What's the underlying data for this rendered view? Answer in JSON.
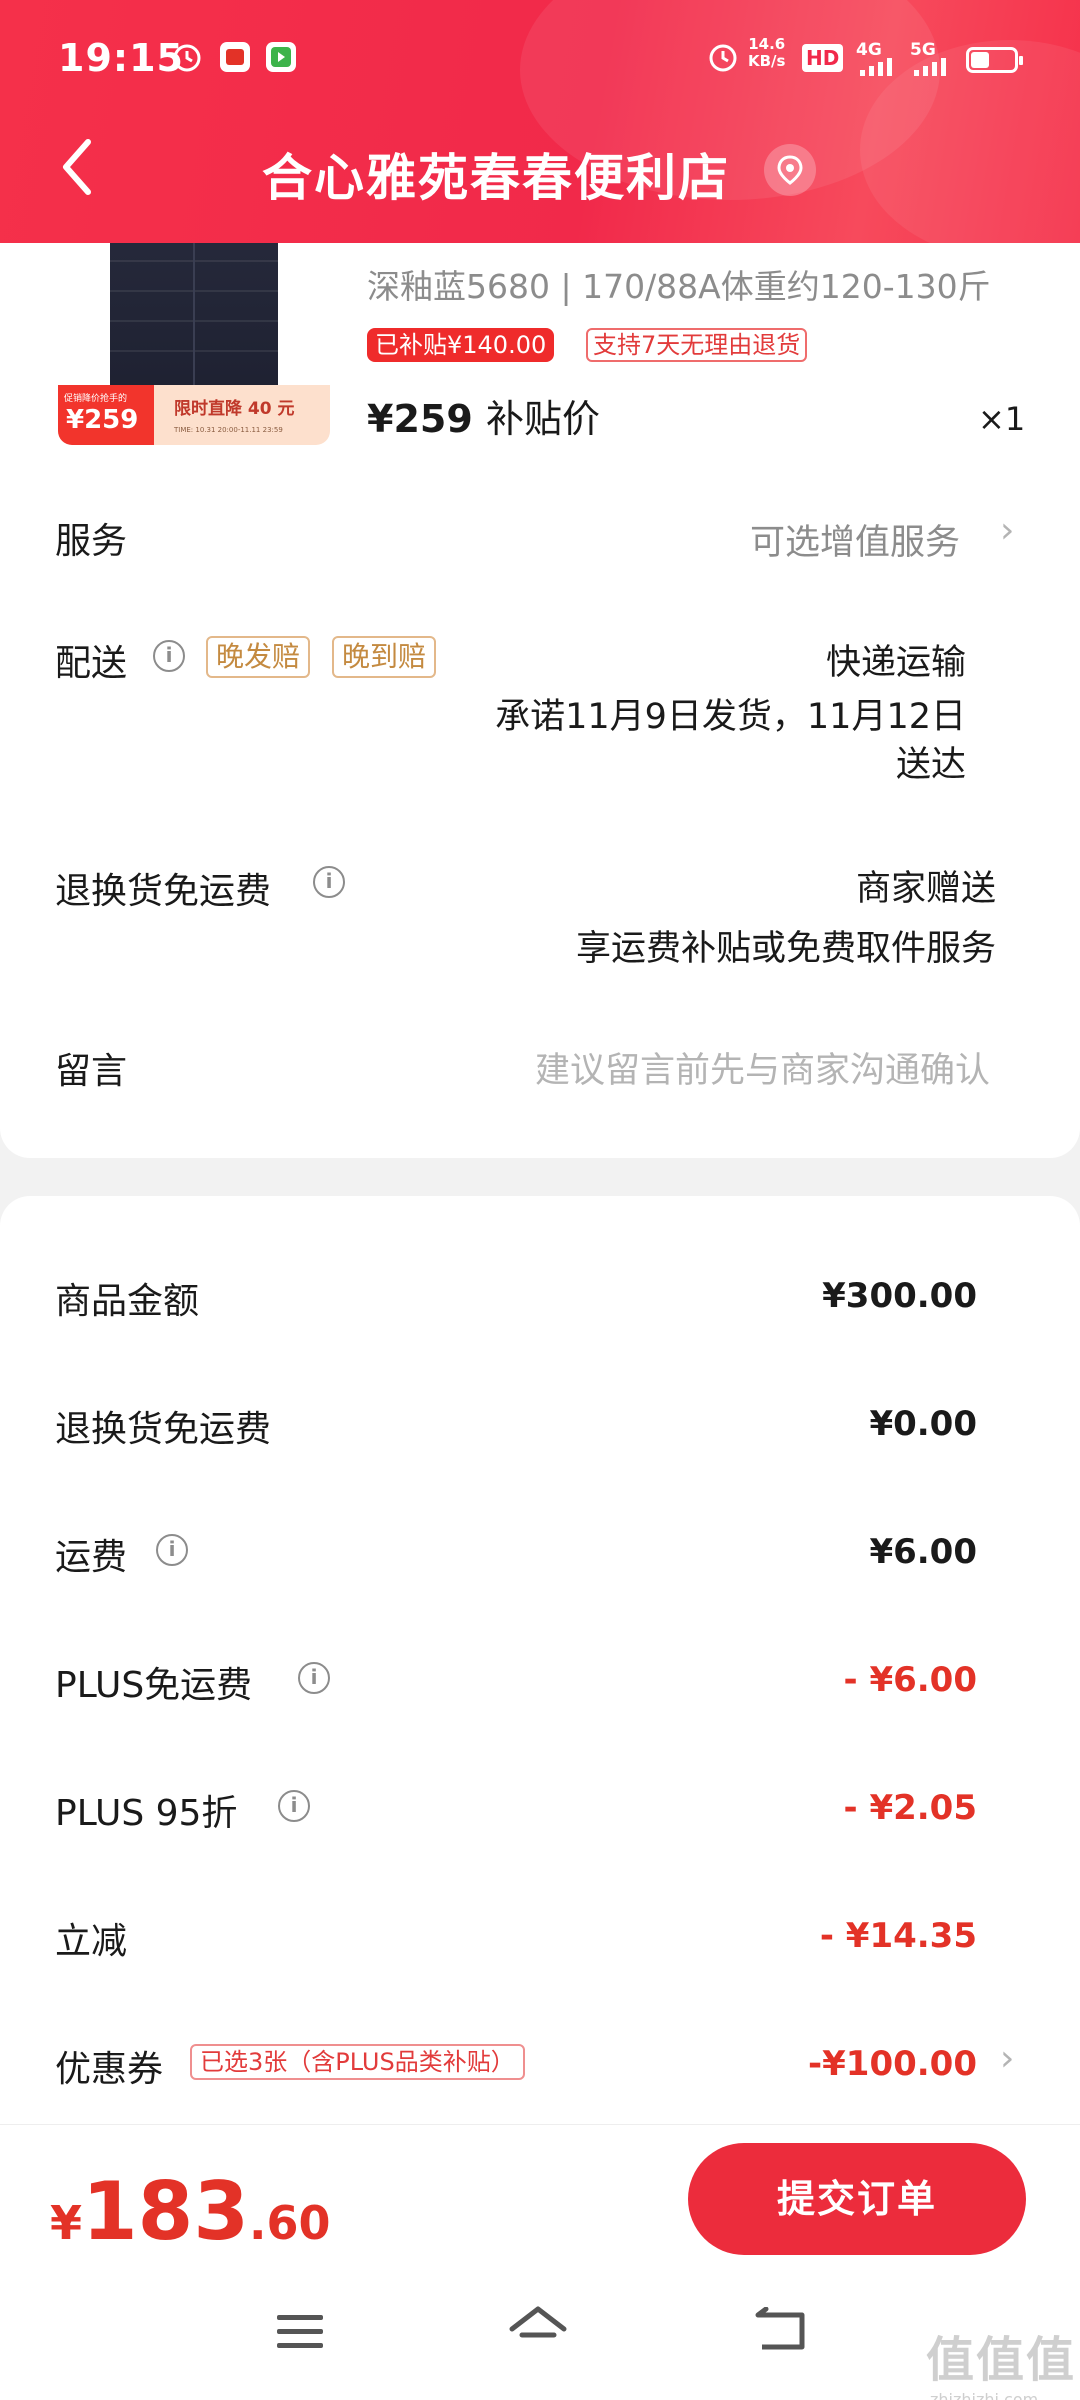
{
  "status_bar": {
    "time": "19:15",
    "net_speed_value": "14.6",
    "net_speed_unit": "KB/s",
    "hd_label": "HD",
    "sim1_label": "4G",
    "sim2_label": "5G",
    "icons": [
      "alarm-icon",
      "app-icon",
      "app-icon",
      "alarm-icon",
      "signal-icon",
      "battery-icon"
    ]
  },
  "header": {
    "back_icon": "chevron-left-icon",
    "shop_name": "合心雅苑春春便利店",
    "location_icon": "location-pin-icon"
  },
  "product": {
    "promo_small_text": "促销降价抢手的",
    "promo_price": "¥259",
    "promo_text": "限时直降 40 元",
    "promo_time": "TIME: 10.31 20:00-11.11 23:59",
    "sku": "深釉蓝5680 | 170/88A体重约120-130斤",
    "subsidy_badge": "已补贴¥140.00",
    "return_badge": "支持7天无理由退货",
    "price": "¥259",
    "price_label": "补贴价",
    "quantity": "×1"
  },
  "order_options": {
    "service_label": "服务",
    "service_value": "可选增值服务",
    "delivery_label": "配送",
    "delivery_tags": [
      "晚发赔",
      "晚到赔"
    ],
    "delivery_method": "快递运输",
    "delivery_promise_line1": "承诺11月9日发货，11月12日",
    "delivery_promise_line2": "送达",
    "return_label": "退换货免运费",
    "return_value": "商家赠送",
    "return_desc": "享运费补贴或免费取件服务",
    "message_label": "留言",
    "message_placeholder": "建议留言前先与商家沟通确认"
  },
  "summary": {
    "rows": [
      {
        "label": "商品金额",
        "value": "¥300.00"
      },
      {
        "label": "退换货免运费",
        "value": "¥0.00"
      },
      {
        "label": "运费",
        "value": "¥6.00"
      },
      {
        "label": "PLUS免运费",
        "value": "- ¥6.00"
      },
      {
        "label": "PLUS 95折",
        "value": "- ¥2.05"
      },
      {
        "label": "立减",
        "value": "- ¥14.35"
      },
      {
        "label": "优惠券",
        "value": "-¥100.00"
      }
    ],
    "coupon_tag": "已选3张（含PLUS品类补贴）"
  },
  "bottom": {
    "currency": "¥",
    "total_int": "183",
    "total_dec": ".60",
    "submit_label": "提交订单"
  },
  "nav": {
    "menu_icon": "menu-icon",
    "home_icon": "home-icon",
    "back_icon": "back-icon"
  },
  "watermark": {
    "glyphs": "值值值",
    "url": "zhizhizhi.com"
  },
  "colors": {
    "accent_red": "#ec2c3c",
    "price_red": "#e33227",
    "tag_gold": "#c48a40"
  }
}
